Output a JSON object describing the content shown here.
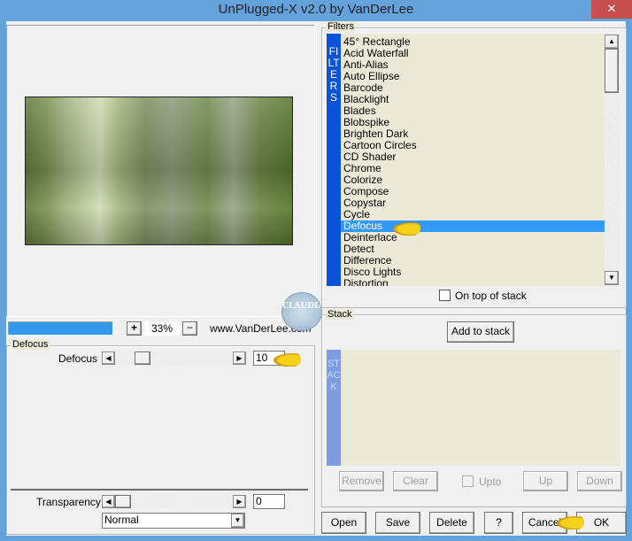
{
  "window": {
    "title": "UnPlugged-X v2.0 by VanDerLee",
    "close_icon": "close-icon"
  },
  "preview": {
    "zoom": "33%",
    "zoom_in": "+",
    "zoom_out": "−",
    "url": "www.VanDerLee.com",
    "progress_percent": 100
  },
  "watermark": "CLAUDIA",
  "params": {
    "group_label": "Defocus",
    "defocus_label": "Defocus",
    "defocus_value": "10",
    "transparency_label": "Transparency",
    "transparency_value": "0",
    "blend_mode": "Normal"
  },
  "filters": {
    "group_label": "Filters",
    "side_label": "FILTERS",
    "selected": "Defocus",
    "items": [
      "45° Rectangle",
      "Acid Waterfall",
      "Anti-Alias",
      "Auto Ellipse",
      "Barcode",
      "Blacklight",
      "Blades",
      "Blobspike",
      "Brighten Dark",
      "Cartoon Circles",
      "CD Shader",
      "Chrome",
      "Colorize",
      "Compose",
      "Copystar",
      "Cycle",
      "Defocus",
      "Deinterlace",
      "Detect",
      "Difference",
      "Disco Lights",
      "Distortion"
    ],
    "on_top_label": "On top of stack"
  },
  "stack": {
    "group_label": "Stack",
    "side_label": "STACK",
    "add_label": "Add to stack",
    "remove_label": "Remove",
    "clear_label": "Clear",
    "upto_label": "Upto",
    "up_label": "Up",
    "down_label": "Down"
  },
  "footer": {
    "open": "Open",
    "save": "Save",
    "delete": "Delete",
    "help": "?",
    "cancel": "Cancel",
    "ok": "OK"
  },
  "colors": {
    "titlebar": "#64a2dc",
    "selection": "#3399ff",
    "filters_bar": "#0a52d8",
    "stack_bar": "#7d9de0",
    "list_bg": "#ece9d8"
  }
}
